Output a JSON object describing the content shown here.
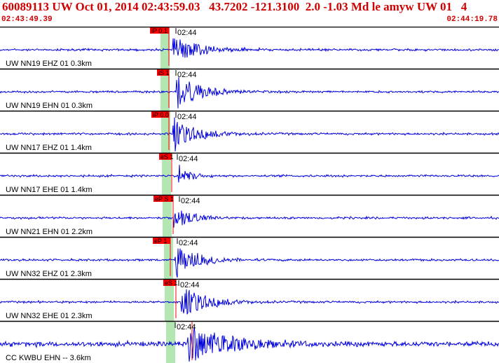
{
  "header": {
    "title": "60089113 UW Oct 01, 2014 02:43:59.03   43.7202 -121.3100  2.0 -1.03 Md le amyw UW 01   4",
    "start_time": "02:43:49.39",
    "end_time": "02:44:19.78"
  },
  "colors": {
    "header_text": "#d00000",
    "trace": "#0000dd",
    "pick_flag": "#ff0000",
    "origin_band": "#b4e6b4",
    "divider": "#000000"
  },
  "panels": [
    {
      "label": "UW NN19 EHZ 01 0.3km",
      "pick": "iP 0.1",
      "time_mark": "02:44",
      "p_time": "02:43:58.93"
    },
    {
      "label": "UW NN19 EHN 01 0.3km",
      "pick": "iS 1",
      "time_mark": "02:44",
      "p_time": "02:43:59.48"
    },
    {
      "label": "UW NN17 EHZ 01 1.4km",
      "pick": "iP 0.0",
      "time_mark": "02:44",
      "p_time": "02:43:59.13"
    },
    {
      "label": "UW NN17 EHE 01 1.4km",
      "pick": "eS 1",
      "time_mark": "02:44",
      "p_time": "02:43:59.67"
    },
    {
      "label": "UW NN21 EHN 01 2.2km",
      "pick": "eP S 1",
      "time_mark": "02:44",
      "p_time": "02:43:59.61"
    },
    {
      "label": "UW NN32 EHZ 01 2.3km",
      "pick": "eP 1",
      "time_mark": "02:44",
      "p_time": "02:43:58.71"
    },
    {
      "label": "UW NN32 EHE 01 2.3km",
      "pick": "eS 1",
      "time_mark": "02:44",
      "p_time": "02:43:59.98"
    },
    {
      "label": "CC KWBU EHN -- 3.6km",
      "pick": "",
      "time_mark": "02:44",
      "p_time": "02:44:00.23"
    }
  ]
}
